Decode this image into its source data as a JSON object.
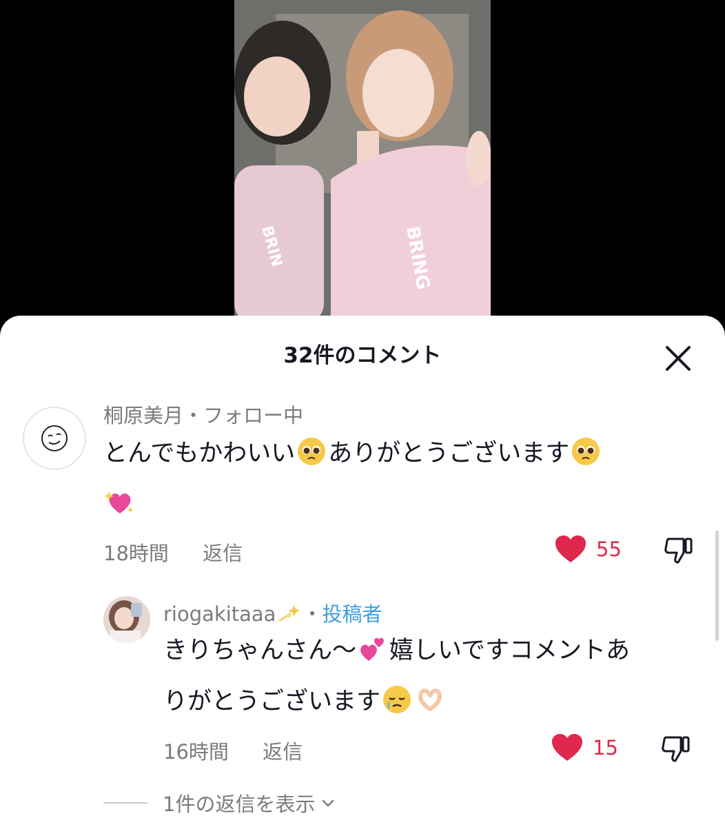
{
  "sheet": {
    "title": "32件のコメント"
  },
  "comments": [
    {
      "username": "桐原美月",
      "separator": "・",
      "relation": "フォロー中",
      "text_line1": "とんでもかわいい",
      "text_line1b": "ありがとうございます",
      "time": "18時間",
      "reply_label": "返信",
      "likes": "55",
      "emojis": [
        "pleading-face-emoji",
        "pleading-face-emoji",
        "sparkling-heart-emoji"
      ]
    },
    {
      "username": "riogakitaaa",
      "separator": "・",
      "author_tag": "投稿者",
      "text_line1a": "きりちゃんさん〜",
      "text_line1b": "嬉しいですコメントあ",
      "text_line2": "りがとうございます",
      "time": "16時間",
      "reply_label": "返信",
      "likes": "15",
      "emojis": [
        "dizzy-emoji",
        "two-hearts-emoji",
        "crying-face-emoji",
        "heart-hands-emoji"
      ]
    }
  ],
  "view_replies": {
    "label": "1件の返信を表示"
  },
  "colors": {
    "like": "#e0274e",
    "author_tag": "#3b9fdd",
    "muted": "#7a7b80",
    "text": "#161823"
  },
  "icons": [
    "close-icon",
    "heart-icon",
    "dislike-icon",
    "chevron-down-icon"
  ]
}
